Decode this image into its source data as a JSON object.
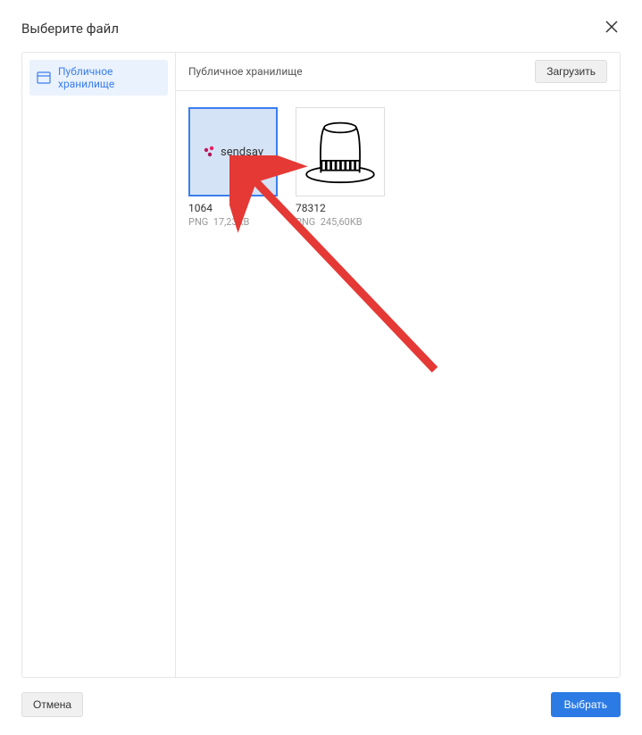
{
  "dialog": {
    "title": "Выберите файл"
  },
  "sidebar": {
    "items": [
      {
        "label": "Публичное хранилище"
      }
    ]
  },
  "main": {
    "breadcrumb": "Публичное хранилище",
    "upload_label": "Загрузить"
  },
  "files": [
    {
      "name": "1064",
      "type": "PNG",
      "size": "17,23KB",
      "thumb_label": "sendsay",
      "selected": true
    },
    {
      "name": "78312",
      "type": "PNG",
      "size": "245,60KB",
      "thumb_label": "hat",
      "selected": false
    }
  ],
  "footer": {
    "cancel_label": "Отмена",
    "select_label": "Выбрать"
  }
}
